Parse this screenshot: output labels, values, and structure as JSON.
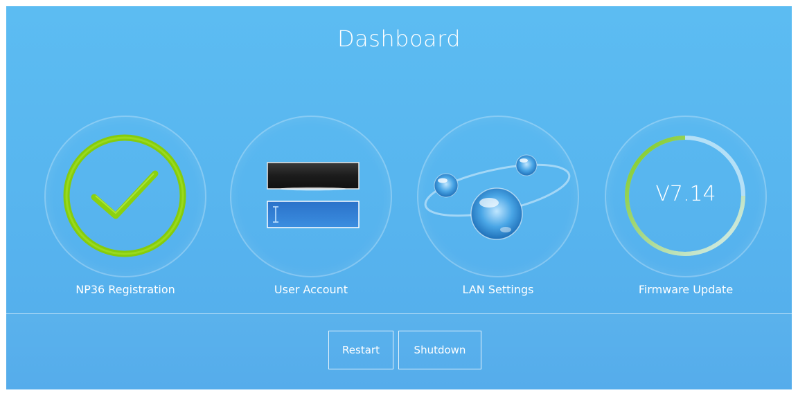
{
  "header": {
    "title": "Dashboard"
  },
  "tiles": [
    {
      "label": "NP36 Registration",
      "icon": "checkmark-icon"
    },
    {
      "label": "User Account",
      "icon": "login-fields-icon"
    },
    {
      "label": "LAN Settings",
      "icon": "network-orbs-icon"
    },
    {
      "label": "Firmware Update",
      "icon": "progress-ring-icon",
      "version": "V7.14"
    }
  ],
  "footer": {
    "restart_label": "Restart",
    "shutdown_label": "Shutdown"
  },
  "colors": {
    "background": "#5cbcf2",
    "accent_green": "#8bd10e",
    "text": "#ffffff"
  }
}
